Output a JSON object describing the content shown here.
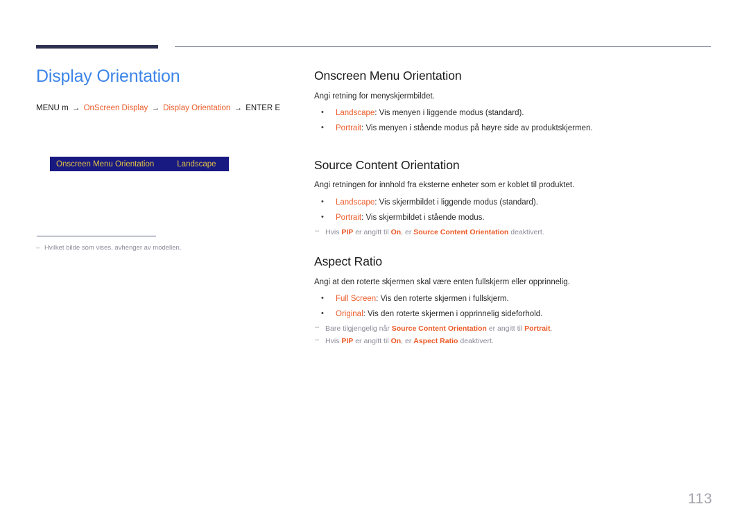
{
  "header": {
    "accent_bar_color": "#2e3050",
    "divider_color": "#5a5f7d"
  },
  "left": {
    "page_title": "Display Orientation",
    "breadcrumb": {
      "menu_label": "MENU",
      "menu_key_icon": "m",
      "arrow1": "→",
      "path1": "OnScreen Display",
      "arrow2": "→",
      "path2": "Display Orientation",
      "arrow3": "→",
      "enter_label": "ENTER",
      "enter_key_icon": "E"
    },
    "osd_box": {
      "label": "Onscreen Menu Orientation",
      "value": "Landscape",
      "background": "#191982",
      "text_color": "#e0c243"
    },
    "footnote": {
      "dash": "–",
      "text": "Hvilket bilde som vises, avhenger av modellen."
    }
  },
  "right": {
    "sections": [
      {
        "title": "Onscreen Menu Orientation",
        "intro": "Angi retning for menyskjermbildet.",
        "bullets": [
          {
            "term": "Landscape",
            "sep": ": ",
            "text": "Vis menyen i liggende modus (standard)."
          },
          {
            "term": "Portrait",
            "sep": ": ",
            "text": "Vis menyen i stående modus på høyre side av produktskjermen."
          }
        ],
        "notes": []
      },
      {
        "title": "Source Content Orientation",
        "intro": "Angi retningen for innhold fra eksterne enheter som er koblet til produktet.",
        "bullets": [
          {
            "term": "Landscape",
            "sep": ": ",
            "text": "Vis skjermbildet i liggende modus (standard)."
          },
          {
            "term": "Portrait",
            "sep": ": ",
            "text": "Vis skjermbildet i stående modus."
          }
        ],
        "notes": [
          {
            "parts": [
              {
                "t": "Hvis ",
                "k": "plain"
              },
              {
                "t": "PIP",
                "k": "term"
              },
              {
                "t": " er angitt til ",
                "k": "plain"
              },
              {
                "t": "On",
                "k": "term"
              },
              {
                "t": ", er ",
                "k": "plain"
              },
              {
                "t": "Source Content Orientation",
                "k": "term"
              },
              {
                "t": " deaktivert.",
                "k": "plain"
              }
            ]
          }
        ]
      },
      {
        "title": "Aspect Ratio",
        "intro": "Angi at den roterte skjermen skal være enten fullskjerm eller opprinnelig.",
        "bullets": [
          {
            "term": "Full Screen",
            "sep": ": ",
            "text": "Vis den roterte skjermen i fullskjerm."
          },
          {
            "term": "Original",
            "sep": ": ",
            "text": "Vis den roterte skjermen i opprinnelig sideforhold."
          }
        ],
        "notes": [
          {
            "parts": [
              {
                "t": "Bare tilgjengelig når ",
                "k": "plain"
              },
              {
                "t": "Source Content Orientation",
                "k": "term"
              },
              {
                "t": " er angitt til ",
                "k": "plain"
              },
              {
                "t": "Portrait",
                "k": "term"
              },
              {
                "t": ".",
                "k": "plain"
              }
            ]
          },
          {
            "parts": [
              {
                "t": "Hvis ",
                "k": "plain"
              },
              {
                "t": "PIP",
                "k": "term"
              },
              {
                "t": " er angitt til ",
                "k": "plain"
              },
              {
                "t": "On",
                "k": "term"
              },
              {
                "t": ", er ",
                "k": "plain"
              },
              {
                "t": "Aspect Ratio",
                "k": "term"
              },
              {
                "t": " deaktivert.",
                "k": "plain"
              }
            ]
          }
        ]
      }
    ]
  },
  "footer": {
    "page_number": "113"
  },
  "colors": {
    "title_blue": "#3d85e8",
    "accent_orange": "#eb5b28",
    "note_gray": "#8c8c99",
    "page_number_gray": "#a5a5ad"
  }
}
